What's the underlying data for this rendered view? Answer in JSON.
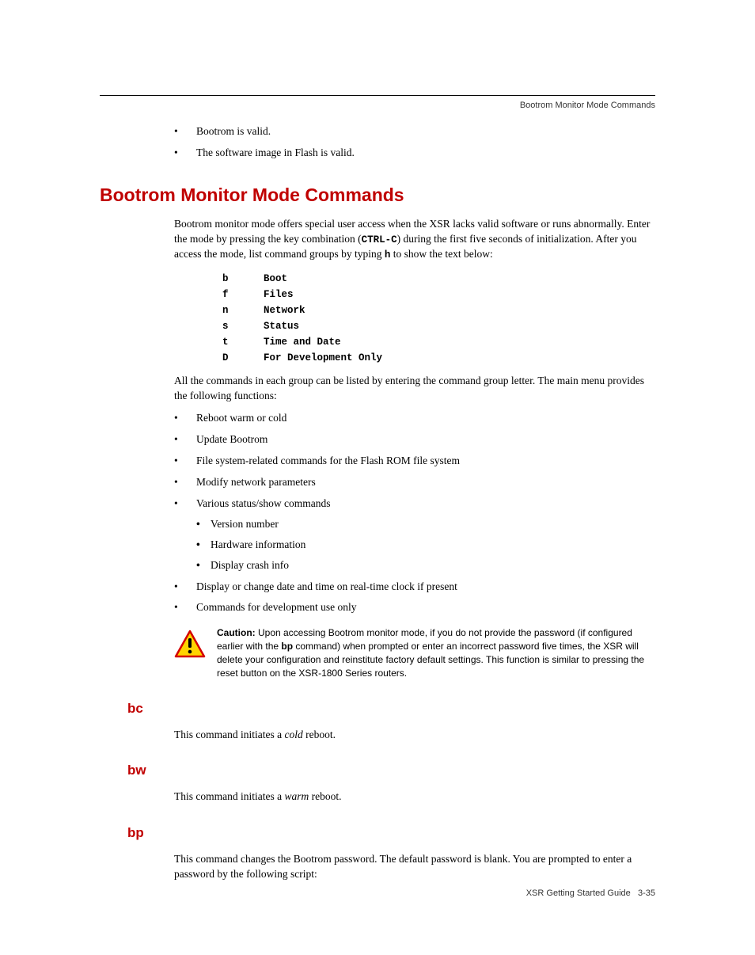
{
  "header": {
    "running_title": "Bootrom Monitor Mode Commands"
  },
  "intro_bullets": [
    "Bootrom is valid.",
    "The software image in Flash is valid."
  ],
  "section": {
    "title": "Bootrom Monitor Mode Commands",
    "p1_a": "Bootrom monitor mode offers special user access when the XSR lacks valid software or runs abnormally. Enter the mode by pressing the key combination (",
    "p1_code1": "CTRL-C",
    "p1_b": ") during the first five seconds of initialization. After you access the mode, list command groups by typing ",
    "p1_code2": "h",
    "p1_c": " to show the text below:",
    "cmds": [
      {
        "key": "b",
        "label": "Boot"
      },
      {
        "key": "f",
        "label": "Files"
      },
      {
        "key": "n",
        "label": "Network"
      },
      {
        "key": "s",
        "label": "Status"
      },
      {
        "key": "t",
        "label": "Time and Date"
      },
      {
        "key": "D",
        "label": "For Development Only"
      }
    ],
    "p2": "All the commands in each group can be listed by entering the command group letter. The main menu provides the following functions:",
    "func_bullets": [
      {
        "text": "Reboot warm or cold"
      },
      {
        "text": "Update Bootrom"
      },
      {
        "text": "File system-related commands for the Flash ROM file system"
      },
      {
        "text": "Modify network parameters"
      },
      {
        "text": "Various status/show commands",
        "sub": [
          "Version number",
          "Hardware information",
          "Display crash info"
        ]
      },
      {
        "text": "Display or change date and time on real-time clock if present"
      },
      {
        "text": "Commands for development use only"
      }
    ],
    "caution": {
      "label": "Caution:",
      "text_a": " Upon accessing Bootrom monitor mode, if you do not provide the password (if configured earlier with the ",
      "bold1": "bp",
      "text_b": " command) when prompted or enter an incorrect password five times, the XSR will delete your configuration and reinstitute factory default settings. This function is similar to pressing the reset button on the XSR-1800 Series routers."
    }
  },
  "commands": {
    "bc": {
      "heading": "bc",
      "pre": "This command initiates a ",
      "italic": "cold",
      "post": " reboot."
    },
    "bw": {
      "heading": "bw",
      "pre": "This command initiates a ",
      "italic": "warm",
      "post": " reboot."
    },
    "bp": {
      "heading": "bp",
      "text": "This command changes the Bootrom password. The default password is blank. You are prompted to enter a password by the following script:"
    }
  },
  "footer": {
    "left": "XSR Getting Started Guide",
    "right": "3-35"
  }
}
